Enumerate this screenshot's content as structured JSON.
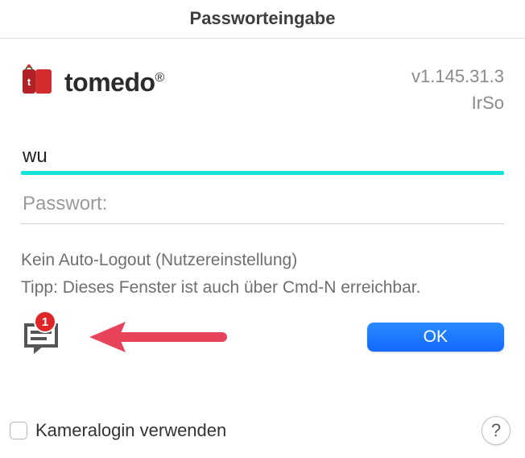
{
  "window": {
    "title": "Passworteingabe"
  },
  "header": {
    "brand_name": "tomedo",
    "brand_suffix": "®",
    "version": "v1.145.31.3",
    "user_short": "IrSo"
  },
  "fields": {
    "username_value": "wu",
    "password_label": "Passwort:"
  },
  "info": {
    "line1": "Kein Auto-Logout (Nutzereinstellung)",
    "line2": "Tipp: Dieses Fenster ist auch über Cmd-N erreichbar."
  },
  "actions": {
    "ok_label": "OK",
    "notification_count": "1"
  },
  "bottom": {
    "kameralogin_label": "Kameralogin verwenden",
    "help_label": "?"
  },
  "colors": {
    "accent_underline": "#14e3d8",
    "primary_button": "#1269ff",
    "badge": "#e02626"
  }
}
